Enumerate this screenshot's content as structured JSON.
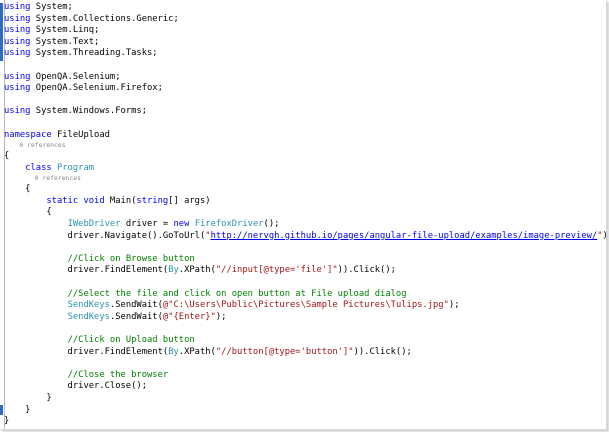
{
  "colors": {
    "keyword": "#0000ff",
    "type": "#2b91af",
    "string": "#a31515",
    "comment": "#008000",
    "link": "#0000ee",
    "text": "#000000",
    "codelens": "#888888",
    "change_bar": "#2e6ac7"
  },
  "editor": {
    "code_lines": [
      [
        {
          "t": "using",
          "c": "kw"
        },
        {
          "t": " System;",
          "c": "plain"
        }
      ],
      [
        {
          "t": "using",
          "c": "kw"
        },
        {
          "t": " System.Collections.Generic;",
          "c": "plain"
        }
      ],
      [
        {
          "t": "using",
          "c": "kw"
        },
        {
          "t": " System.Linq;",
          "c": "plain"
        }
      ],
      [
        {
          "t": "using",
          "c": "kw"
        },
        {
          "t": " System.Text;",
          "c": "plain"
        }
      ],
      [
        {
          "t": "using",
          "c": "kw"
        },
        {
          "t": " System.Threading.Tasks;",
          "c": "plain"
        }
      ],
      [],
      [
        {
          "t": "using",
          "c": "kw"
        },
        {
          "t": " OpenQA.Selenium;",
          "c": "plain"
        }
      ],
      [
        {
          "t": "using",
          "c": "kw"
        },
        {
          "t": " OpenQA.Selenium.Firefox;",
          "c": "plain"
        }
      ],
      [],
      [
        {
          "t": "using",
          "c": "kw"
        },
        {
          "t": " System.Windows.Forms;",
          "c": "plain"
        }
      ],
      [],
      [
        {
          "t": "namespace",
          "c": "kw"
        },
        {
          "t": " FileUpload",
          "c": "plain"
        }
      ],
      [
        {
          "t": "{",
          "c": "plain"
        }
      ],
      [
        {
          "t": "    ",
          "c": "plain"
        },
        {
          "t": "class",
          "c": "kw"
        },
        {
          "t": " ",
          "c": "plain"
        },
        {
          "t": "Program",
          "c": "type"
        }
      ],
      [
        {
          "t": "    {",
          "c": "plain"
        }
      ],
      [
        {
          "t": "        ",
          "c": "plain"
        },
        {
          "t": "static",
          "c": "kw"
        },
        {
          "t": " ",
          "c": "plain"
        },
        {
          "t": "void",
          "c": "kw"
        },
        {
          "t": " Main(",
          "c": "plain"
        },
        {
          "t": "string",
          "c": "kw"
        },
        {
          "t": "[] args)",
          "c": "plain"
        }
      ],
      [
        {
          "t": "        {",
          "c": "plain"
        }
      ],
      [
        {
          "t": "            ",
          "c": "plain"
        },
        {
          "t": "IWebDriver",
          "c": "type"
        },
        {
          "t": " driver = ",
          "c": "plain"
        },
        {
          "t": "new",
          "c": "kw"
        },
        {
          "t": " ",
          "c": "plain"
        },
        {
          "t": "FirefoxDriver",
          "c": "type"
        },
        {
          "t": "();",
          "c": "plain"
        }
      ],
      [
        {
          "t": "            driver.Navigate().GoToUrl(",
          "c": "plain"
        },
        {
          "t": "\"",
          "c": "str"
        },
        {
          "t": "http://nervgh.github.io/pages/angular-file-upload/examples/image-preview/",
          "c": "link"
        },
        {
          "t": "\"",
          "c": "str"
        },
        {
          "t": ");",
          "c": "plain"
        }
      ],
      [],
      [
        {
          "t": "            ",
          "c": "plain"
        },
        {
          "t": "//Click on Browse button",
          "c": "cmt"
        }
      ],
      [
        {
          "t": "            driver.FindElement(",
          "c": "plain"
        },
        {
          "t": "By",
          "c": "type"
        },
        {
          "t": ".XPath(",
          "c": "plain"
        },
        {
          "t": "\"//input[@type='file']\"",
          "c": "str"
        },
        {
          "t": ")).Click();",
          "c": "plain"
        }
      ],
      [],
      [
        {
          "t": "            ",
          "c": "plain"
        },
        {
          "t": "//Select the file and click on open button at File upload dialog",
          "c": "cmt"
        }
      ],
      [
        {
          "t": "            ",
          "c": "plain"
        },
        {
          "t": "SendKeys",
          "c": "type"
        },
        {
          "t": ".SendWait(",
          "c": "plain"
        },
        {
          "t": "@\"C:\\Users\\Public\\Pictures\\Sample Pictures\\Tulips.jpg\"",
          "c": "str"
        },
        {
          "t": ");",
          "c": "plain"
        }
      ],
      [
        {
          "t": "            ",
          "c": "plain"
        },
        {
          "t": "SendKeys",
          "c": "type"
        },
        {
          "t": ".SendWait(",
          "c": "plain"
        },
        {
          "t": "@\"{Enter}\"",
          "c": "str"
        },
        {
          "t": ");",
          "c": "plain"
        }
      ],
      [],
      [
        {
          "t": "            ",
          "c": "plain"
        },
        {
          "t": "//Click on Upload button",
          "c": "cmt"
        }
      ],
      [
        {
          "t": "            driver.FindElement(",
          "c": "plain"
        },
        {
          "t": "By",
          "c": "type"
        },
        {
          "t": ".XPath(",
          "c": "plain"
        },
        {
          "t": "\"//button[@type='button']\"",
          "c": "str"
        },
        {
          "t": ")).Click();",
          "c": "plain"
        }
      ],
      [],
      [
        {
          "t": "            ",
          "c": "plain"
        },
        {
          "t": "//Close the browser",
          "c": "cmt"
        }
      ],
      [
        {
          "t": "            driver.Close();",
          "c": "plain"
        }
      ],
      [
        {
          "t": "        }",
          "c": "plain"
        }
      ],
      [
        {
          "t": "    }",
          "c": "plain"
        }
      ],
      [
        {
          "t": "}",
          "c": "plain"
        }
      ]
    ],
    "codelens": [
      {
        "text": "0 references",
        "indent": "    ",
        "after_line": 12
      },
      {
        "text": "0 references",
        "indent": "        ",
        "after_line": 14
      }
    ]
  }
}
